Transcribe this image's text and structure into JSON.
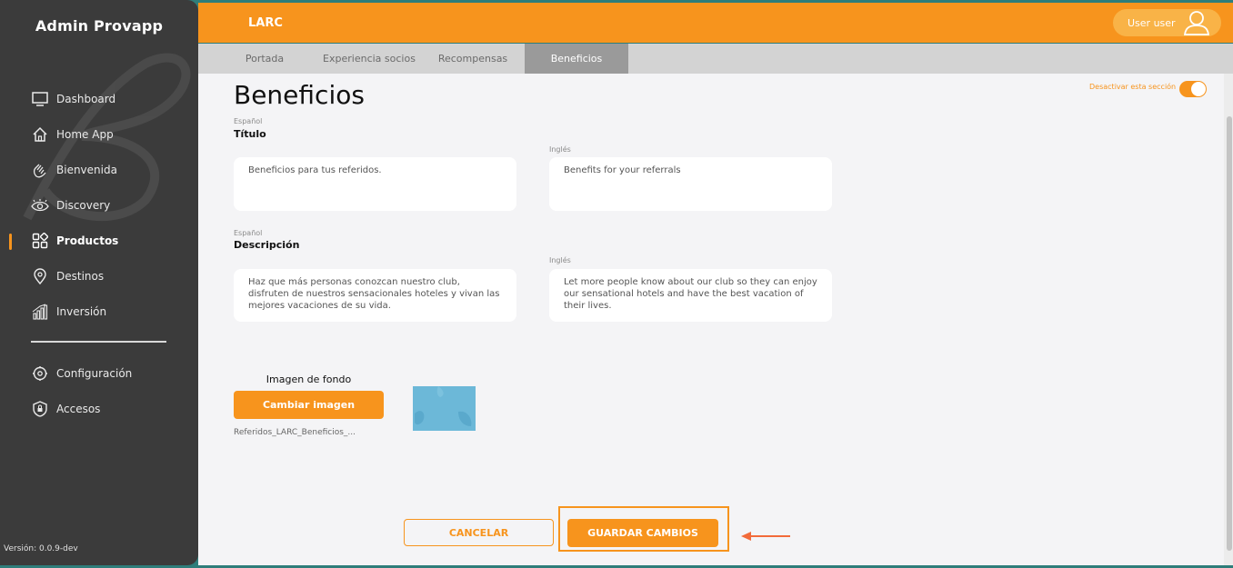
{
  "sidebar": {
    "title": "Admin Provapp",
    "items": [
      {
        "label": "Dashboard",
        "icon": "monitor-icon"
      },
      {
        "label": "Home App",
        "icon": "house-icon"
      },
      {
        "label": "Bienvenida",
        "icon": "hand-wave-icon"
      },
      {
        "label": "Discovery",
        "icon": "eye-icon"
      },
      {
        "label": "Productos",
        "icon": "grid-icon",
        "active": true
      },
      {
        "label": "Destinos",
        "icon": "map-pin-icon"
      },
      {
        "label": "Inversión",
        "icon": "bar-chart-icon"
      }
    ],
    "settings_items": [
      {
        "label": "Configuración",
        "icon": "gear-icon"
      },
      {
        "label": "Accesos",
        "icon": "shield-icon"
      }
    ],
    "version": "Versión: 0.0.9-dev"
  },
  "header": {
    "title": "LARC",
    "user_label": "User user"
  },
  "tabs": [
    {
      "label": "Portada"
    },
    {
      "label": "Experiencia socios"
    },
    {
      "label": "Recompensas"
    },
    {
      "label": "Beneficios",
      "active": true
    }
  ],
  "page": {
    "title": "Beneficios",
    "toggle_label": "Desactivar esta sección",
    "toggle_on": true,
    "titulo": {
      "lang_es": "Español",
      "label": "Título",
      "lang_en": "Inglés",
      "value_es": "Beneficios para tus referidos.",
      "value_en": "Benefits for your referrals"
    },
    "descripcion": {
      "lang_es": "Español",
      "label": "Descripción",
      "lang_en": "Inglés",
      "value_es": "Haz que más personas conozcan nuestro club, disfruten de nuestros sensacionales hoteles y vivan las mejores vacaciones de su vida.",
      "value_en": "Let more people know about our club so they can enjoy our sensational hotels and have the best vacation of their lives."
    },
    "image": {
      "label": "Imagen de fondo",
      "button": "Cambiar imagen",
      "file_name": "Referidos_LARC_Beneficios_..."
    },
    "actions": {
      "cancel": "CANCELAR",
      "save": "GUARDAR CAMBIOS"
    }
  },
  "colors": {
    "accent": "#f7941d",
    "sidebar_bg": "#3b3b3b",
    "tab_active": "#9a9a9a"
  }
}
